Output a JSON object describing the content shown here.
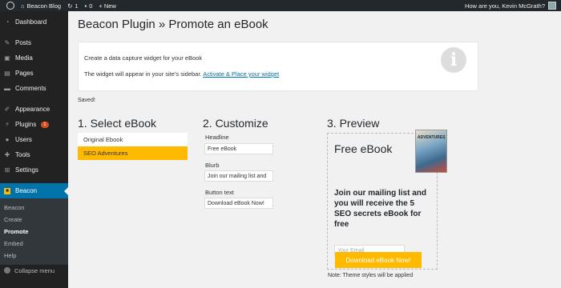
{
  "adminbar": {
    "site_name": "Beacon Blog",
    "updates_count": "1",
    "comments_count": "0",
    "new_label": "+ New",
    "greeting": "How are you, Kevin McGrath?"
  },
  "sidebar": {
    "items": [
      {
        "label": "Dashboard",
        "icon": "dashboard-icon"
      },
      {
        "label": "Posts",
        "icon": "pin-icon"
      },
      {
        "label": "Media",
        "icon": "media-icon"
      },
      {
        "label": "Pages",
        "icon": "page-icon"
      },
      {
        "label": "Comments",
        "icon": "comment-icon"
      },
      {
        "label": "Appearance",
        "icon": "brush-icon"
      },
      {
        "label": "Plugins",
        "icon": "plug-icon",
        "badge": "1"
      },
      {
        "label": "Users",
        "icon": "user-icon"
      },
      {
        "label": "Tools",
        "icon": "wrench-icon"
      },
      {
        "label": "Settings",
        "icon": "settings-icon"
      },
      {
        "label": "Beacon",
        "icon": "beacon-icon"
      }
    ],
    "submenu": [
      "Beacon",
      "Create",
      "Promote",
      "Embed",
      "Help"
    ],
    "collapse_label": "Collapse menu"
  },
  "page": {
    "title": "Beacon Plugin » Promote an eBook",
    "notice_line1": "Create a data capture widget for your eBook",
    "notice_line2_prefix": "The widget will appear in your site's sidebar. ",
    "notice_link": "Activate & Place your widget",
    "saved": "Saved!"
  },
  "select": {
    "title": "1. Select eBook",
    "options": [
      "Original Ebook",
      "SEO Adventures"
    ],
    "selected_index": 1
  },
  "customize": {
    "title": "2. Customize",
    "headline_label": "Headline",
    "headline_value": "Free eBook",
    "blurb_label": "Blurb",
    "blurb_value": "Join our mailing list and",
    "button_label": "Button text",
    "button_value": "Download eBook Now!"
  },
  "preview": {
    "title": "3. Preview",
    "headline": "Free eBook",
    "blurb": "Join our mailing list and you will receive the 5 SEO secrets eBook for free",
    "email_placeholder": "Your Email",
    "button": "Download eBook Now!",
    "cover_text": "ADVENTURES",
    "note": "Note: Theme styles will be applied"
  },
  "colors": {
    "admin_bg": "#23282d",
    "sidebar_bg": "#222222",
    "active_blue": "#0073aa",
    "accent_yellow": "#ffba00"
  }
}
